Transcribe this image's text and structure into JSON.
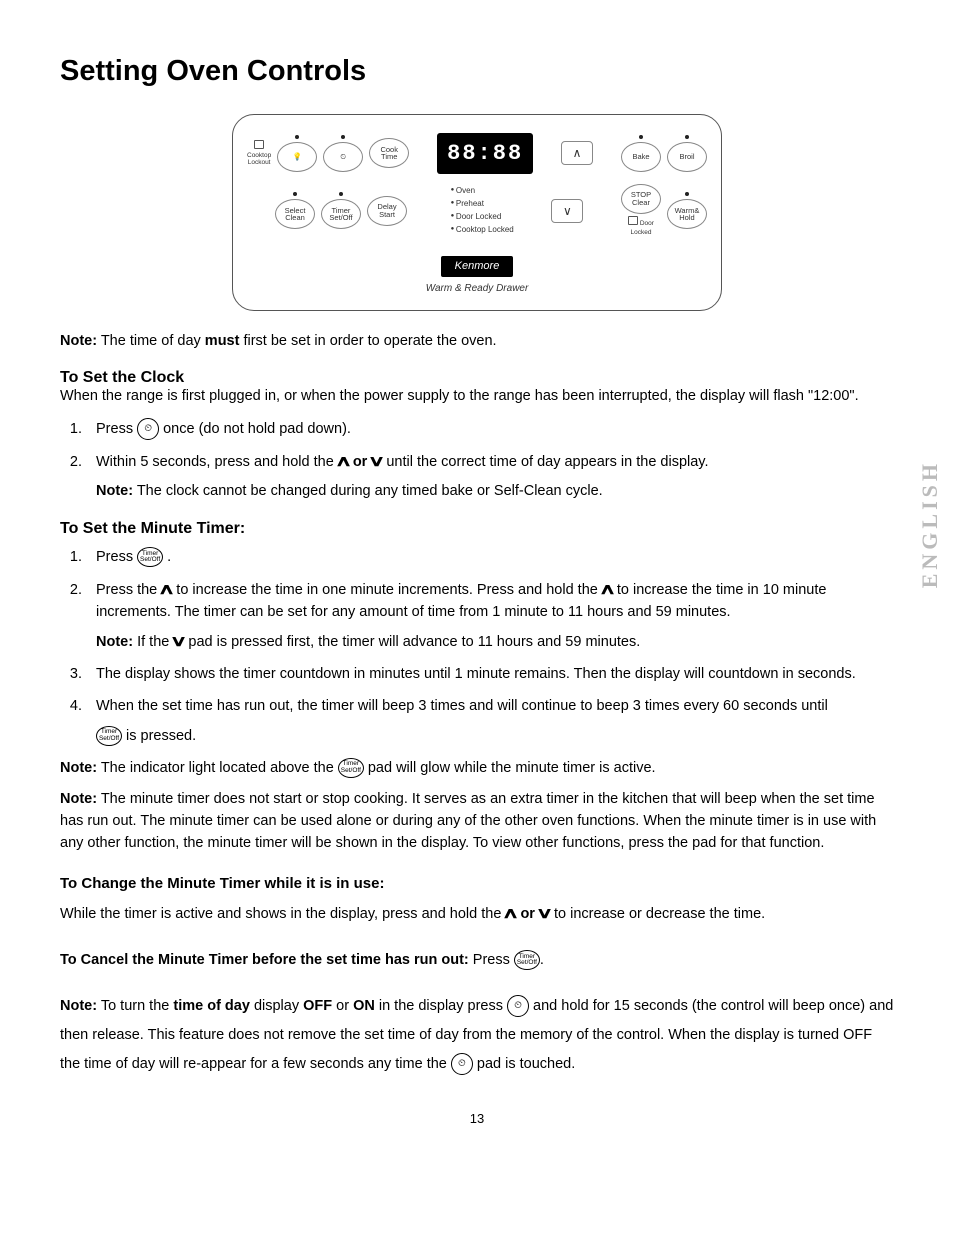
{
  "title": "Setting Oven Controls",
  "sideLabel": "ENGLISH",
  "pageNumber": "13",
  "panel": {
    "lockout": "Cooktop\nLockout",
    "light": "☼",
    "clock": "⏲",
    "cookTime": "Cook\nTime",
    "display": "88:88",
    "bake": "Bake",
    "broil": "Broil",
    "selectClean": "Select\nClean",
    "timer": "Timer\nSet/Off",
    "delayStart": "Delay\nStart",
    "indicators": [
      "Oven",
      "Preheat",
      "Door Locked",
      "Cooktop Locked"
    ],
    "stopClear": "STOP\nClear",
    "warmHold": "Warm&\nHold",
    "doorLocked": "Door\nLocked",
    "brand": "Kenmore",
    "drawer": "Warm & Ready Drawer"
  },
  "noteTop": "Note: The time of day must first be set in order to operate the oven.",
  "clock": {
    "heading": "To Set the Clock",
    "intro": "When the range is first plugged in, or when the power supply to the range has been interrupted, the display will flash \"12:00\".",
    "step1_a": "Press ",
    "step1_b": " once (do not hold pad down).",
    "step2_a": "Within 5 seconds, press and hold the ",
    "step2_or": " or ",
    "step2_b": " until the correct time of day appears in the display.",
    "step2_note": "Note: The clock cannot be changed during any timed bake or Self-Clean cycle."
  },
  "timer": {
    "heading": "To Set the Minute Timer:",
    "step1": "Press ",
    "step2_a": "Press the ",
    "step2_b": " to increase the time in one minute increments. Press and hold the ",
    "step2_c": " to increase the time in 10 minute increments. The timer can be set for any amount of time from 1 minute to 11 hours and 59 minutes.",
    "step2_note_a": "Note: If the ",
    "step2_note_b": " pad is pressed first, the timer will advance to 11 hours and 59 minutes.",
    "step3": "The display shows the timer countdown in minutes until 1 minute remains. Then the display will countdown in seconds.",
    "step4_a": "When the set time has run out, the timer will beep 3 times and will continue to beep 3 times every 60 seconds until ",
    "step4_b": " is pressed.",
    "note1_a": "Note: The indicator light located above the ",
    "note1_b": " pad will glow while the minute timer is active.",
    "note2": "Note: The minute timer does not start or stop cooking. It serves as an extra timer in the kitchen that will beep when the set time has run out. The minute timer can be used alone or during any of the other oven functions. When the minute timer is in use with any other function, the minute timer will be shown in the display. To view other functions, press the pad for that function."
  },
  "change": {
    "heading": "To Change the Minute Timer while it is in use:",
    "text_a": "While the timer is active and shows in the display, press and hold the ",
    "text_or": " or ",
    "text_b": " to increase or decrease the time."
  },
  "cancel": {
    "heading_a": "To Cancel the Minute Timer before the set time has run out: ",
    "heading_b": "Press ",
    "heading_c": "."
  },
  "finalNote": {
    "a": "Note: To turn the time of day display OFF or ON in the display press ",
    "b": " and hold for 15 seconds (the control will beep once) and then release. This feature does not remove the set time of day from the memory of the control. When the display is turned OFF the time of day will re-appear for a few seconds any time the ",
    "c": " pad is touched."
  },
  "icons": {
    "clock": "⏲",
    "timerPad": "Timer\nSet/Off",
    "up": "∧",
    "down": "∨"
  }
}
